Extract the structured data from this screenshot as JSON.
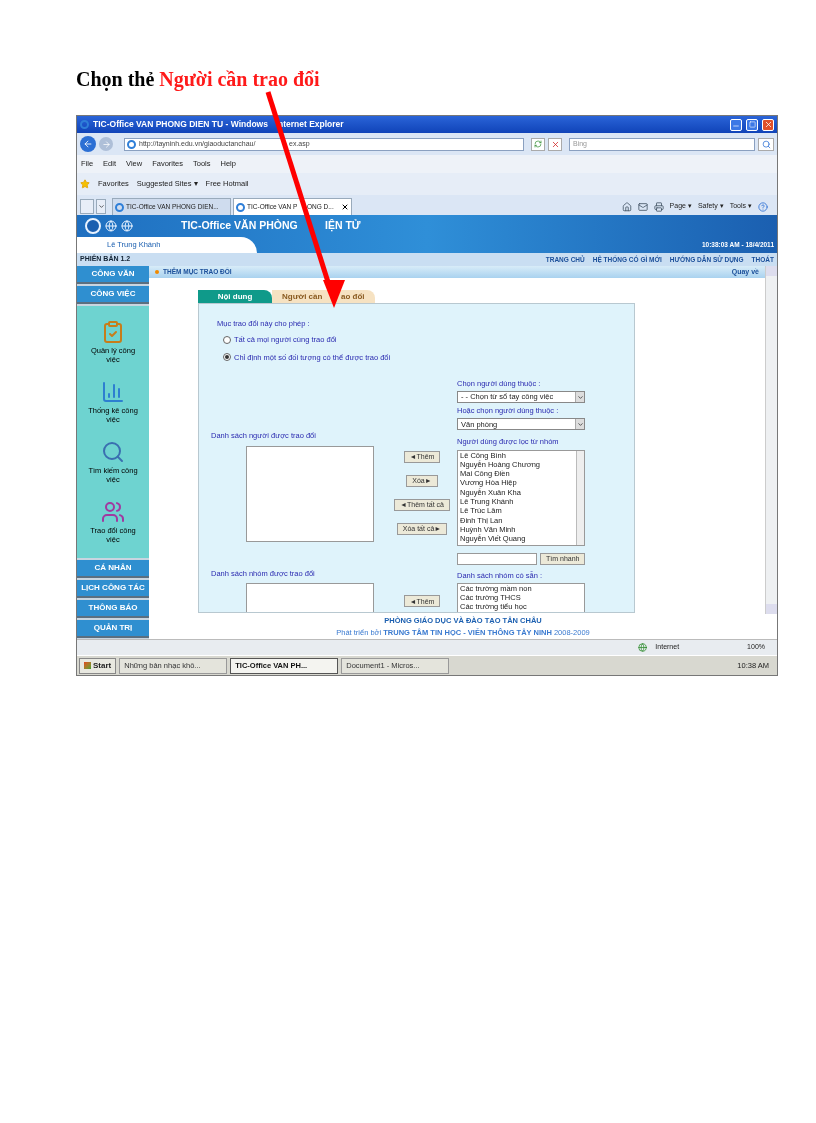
{
  "heading": {
    "lead": "Chọn thẻ ",
    "highlight": "Người cần trao đổi"
  },
  "browser": {
    "title_parts": [
      "TIC-Office VAN PHONG DIEN TU - Windows",
      "nternet Explorer"
    ],
    "url_parts": [
      "http://tayninh.edu.vn/giaoductanchau/",
      "ex.asp"
    ],
    "search_placeholder": "Bing",
    "menu": [
      "File",
      "Edit",
      "View",
      "Favorites",
      "Tools",
      "Help"
    ],
    "favorites": [
      "Favorites",
      "Suggested Sites ▾",
      "Free Hotmail"
    ],
    "tabs": [
      {
        "label_parts": [
          "TIC-Office VAN PHONG DIEN..."
        ],
        "selected": false
      },
      {
        "label_parts": [
          "TIC-Office VAN P",
          "ONG D..."
        ],
        "selected": true
      }
    ],
    "command_bar": [
      "Page ▾",
      "Safety ▾",
      "Tools ▾"
    ],
    "status": {
      "zone": "Internet",
      "zoom": "100%"
    }
  },
  "site": {
    "title_parts": [
      "TIC-Office VĂN PHÒNG",
      "IỆN TỬ"
    ],
    "user": "Lê Trung Khánh",
    "datetime": "10:38:03 AM - 18/4/2011",
    "version": "PHIÊN BẢN 1.2",
    "nav": [
      "TRANG CHỦ",
      "HỆ THỐNG CÓ GÌ MỚI",
      "HƯỚNG DẪN SỬ DỤNG",
      "THOÁT"
    ],
    "sidebar_top": [
      "CÔNG VĂN",
      "CÔNG VIỆC"
    ],
    "sidebar_tools": [
      {
        "kind": "clipboard",
        "label": "Quản lý công việc"
      },
      {
        "kind": "chart",
        "label": "Thống kê công việc"
      },
      {
        "kind": "search",
        "label": "Tìm kiếm công việc"
      },
      {
        "kind": "people",
        "label": "Trao đổi công việc"
      }
    ],
    "sidebar_bottom": [
      "CÁ NHÂN",
      "LỊCH CÔNG TÁC",
      "THÔNG BÁO",
      "QUẢN TRỊ"
    ],
    "section_title": "THÊM MỤC TRAO ĐỔI",
    "back_link": "Quay về",
    "form_tabs": [
      {
        "label_parts": [
          "Nội dung"
        ],
        "selected": true
      },
      {
        "label_parts": [
          "Người cần",
          "ao đổi"
        ],
        "selected": false
      }
    ],
    "permission_label": "Mục trao đổi này cho phép :",
    "permission_options": [
      {
        "label": "Tất cả mọi người cùng trao đổi",
        "selected": false
      },
      {
        "label": "Chỉ định một số đối tượng có thể được trao đổi",
        "selected": true
      }
    ],
    "people_list_label": "Danh sách người được trao đổi",
    "group_list_label": "Danh sách nhóm được trao đổi",
    "person_buttons": [
      "◄Thêm",
      "Xóa►",
      "◄Thêm tất cả",
      "Xóa tất cả►"
    ],
    "group_button": "◄Thêm",
    "source_label": "Chọn người dùng thuộc :",
    "source_value": "- - Chọn từ sổ tay công việc",
    "alt_source_label": "Hoặc chọn người dùng thuộc :",
    "alt_source_value": "Văn phòng",
    "filtered_label": "Người dùng được lọc từ nhóm",
    "filtered_users": [
      "Lê Công Bình",
      "Nguyễn Hoàng Chương",
      "Mai Công Điền",
      "Vương Hòa Hiệp",
      "Nguyễn Xuân Kha",
      "Lê Trung Khánh",
      "Lê Trúc Lâm",
      "Đinh Thị Lan",
      "Huỳnh Văn Minh",
      "Nguyễn Viết Quang"
    ],
    "quick_search_button": "Tìm nhanh",
    "groups_label": "Danh sách nhóm có sẵn :",
    "groups": [
      "Các trường mầm non",
      "Các trường THCS",
      "Các trường tiểu học"
    ],
    "footer_org": "PHÒNG GIÁO DỤC VÀ ĐÀO TẠO TÂN CHÂU",
    "footer_credit": "Phát triển bởi **TRUNG TÂM TIN HỌC - VIỄN THÔNG TÂY NINH** 2008-2009"
  },
  "taskbar": {
    "start": "Start",
    "items": [
      {
        "label": "Những bản nhạc khô...",
        "selected": false
      },
      {
        "label": "TIC-Office VAN PH...",
        "selected": true
      },
      {
        "label": "Document1 - Micros...",
        "selected": false
      }
    ],
    "clock": "10:38 AM"
  }
}
